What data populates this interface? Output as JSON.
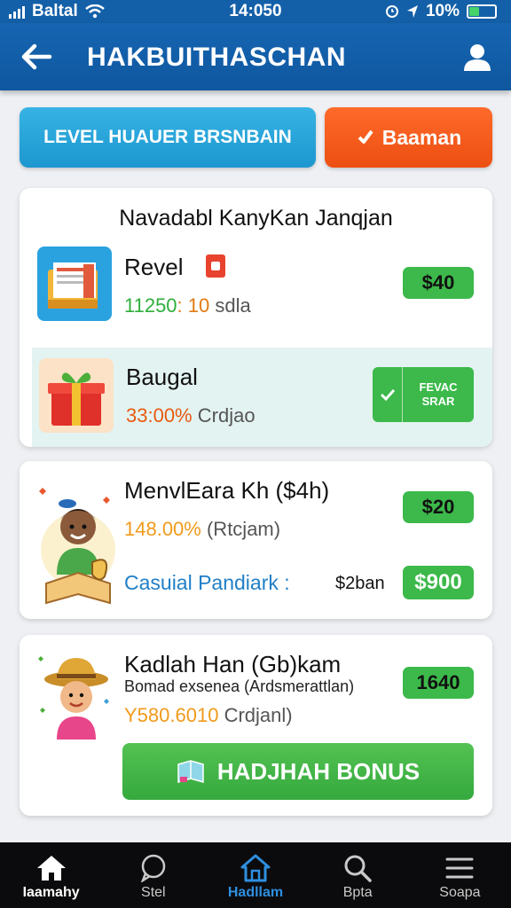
{
  "status_bar": {
    "carrier": "Baltal",
    "time": "14:050",
    "battery": "10%",
    "battery_level": 0.35
  },
  "header": {
    "title": "HAKBUITHASCHAN"
  },
  "top_buttons": {
    "level": "LEVEL HUAUER BRSNBAIN",
    "orange": "Baaman"
  },
  "card1": {
    "title": "Navadabl KanyKan Janqjan",
    "items": [
      {
        "name": "Revel",
        "sub_green": "11250",
        "sub_orange": ": 10",
        "sub_gray": "sdla",
        "price": "$40"
      },
      {
        "name": "Baugal",
        "sub_orange": "33:00%",
        "sub_gray": "Crdjao",
        "cta": "FEVAC\nSRAR"
      }
    ]
  },
  "card2": {
    "name": "MenvlEara Kh ($4h)",
    "sub_orange": "148.00%",
    "sub_gray": "(Rtcjam)",
    "price": "$20",
    "link": "Casuial Pandiark :",
    "extra": "$2ban",
    "price2": "$900"
  },
  "card3": {
    "name": "Kadlah Han (Gb)kam",
    "desc": "Bomad exsenea (Ardsmerattlan)",
    "sub_orange": "Y580.6010",
    "sub_gray": "Crdjanl)",
    "price": "1640",
    "bonus": "HADJHAH BONUS"
  },
  "nav": [
    {
      "label": "Iaamahy",
      "icon": "home-icon"
    },
    {
      "label": "Stel",
      "icon": "chat-icon"
    },
    {
      "label": "Hadllam",
      "icon": "house-outline-icon"
    },
    {
      "label": "Bpta",
      "icon": "search-icon"
    },
    {
      "label": "Soapa",
      "icon": "menu-icon"
    }
  ],
  "colors": {
    "header": "#1460a8",
    "green": "#3cb94a",
    "orange": "#ec4f12",
    "blue": "#1d97cf",
    "nav_active": "#2e8fe0"
  }
}
